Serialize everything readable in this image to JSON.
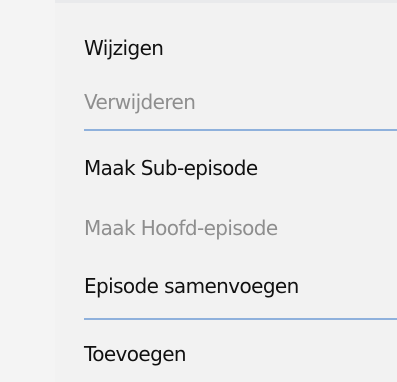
{
  "context_menu": {
    "items": [
      {
        "label": "Wijzigen",
        "enabled": true
      },
      {
        "label": "Verwijderen",
        "enabled": false
      },
      {
        "label": "Maak Sub-episode",
        "enabled": true
      },
      {
        "label": "Maak Hoofd-episode",
        "enabled": false
      },
      {
        "label": "Episode samenvoegen",
        "enabled": true
      },
      {
        "label": "Toevoegen",
        "enabled": true
      }
    ],
    "colors": {
      "background": "#f2f2f2",
      "separator": "#8fb1dc",
      "enabled_text": "#111111",
      "disabled_text": "#8e8e8e"
    }
  }
}
